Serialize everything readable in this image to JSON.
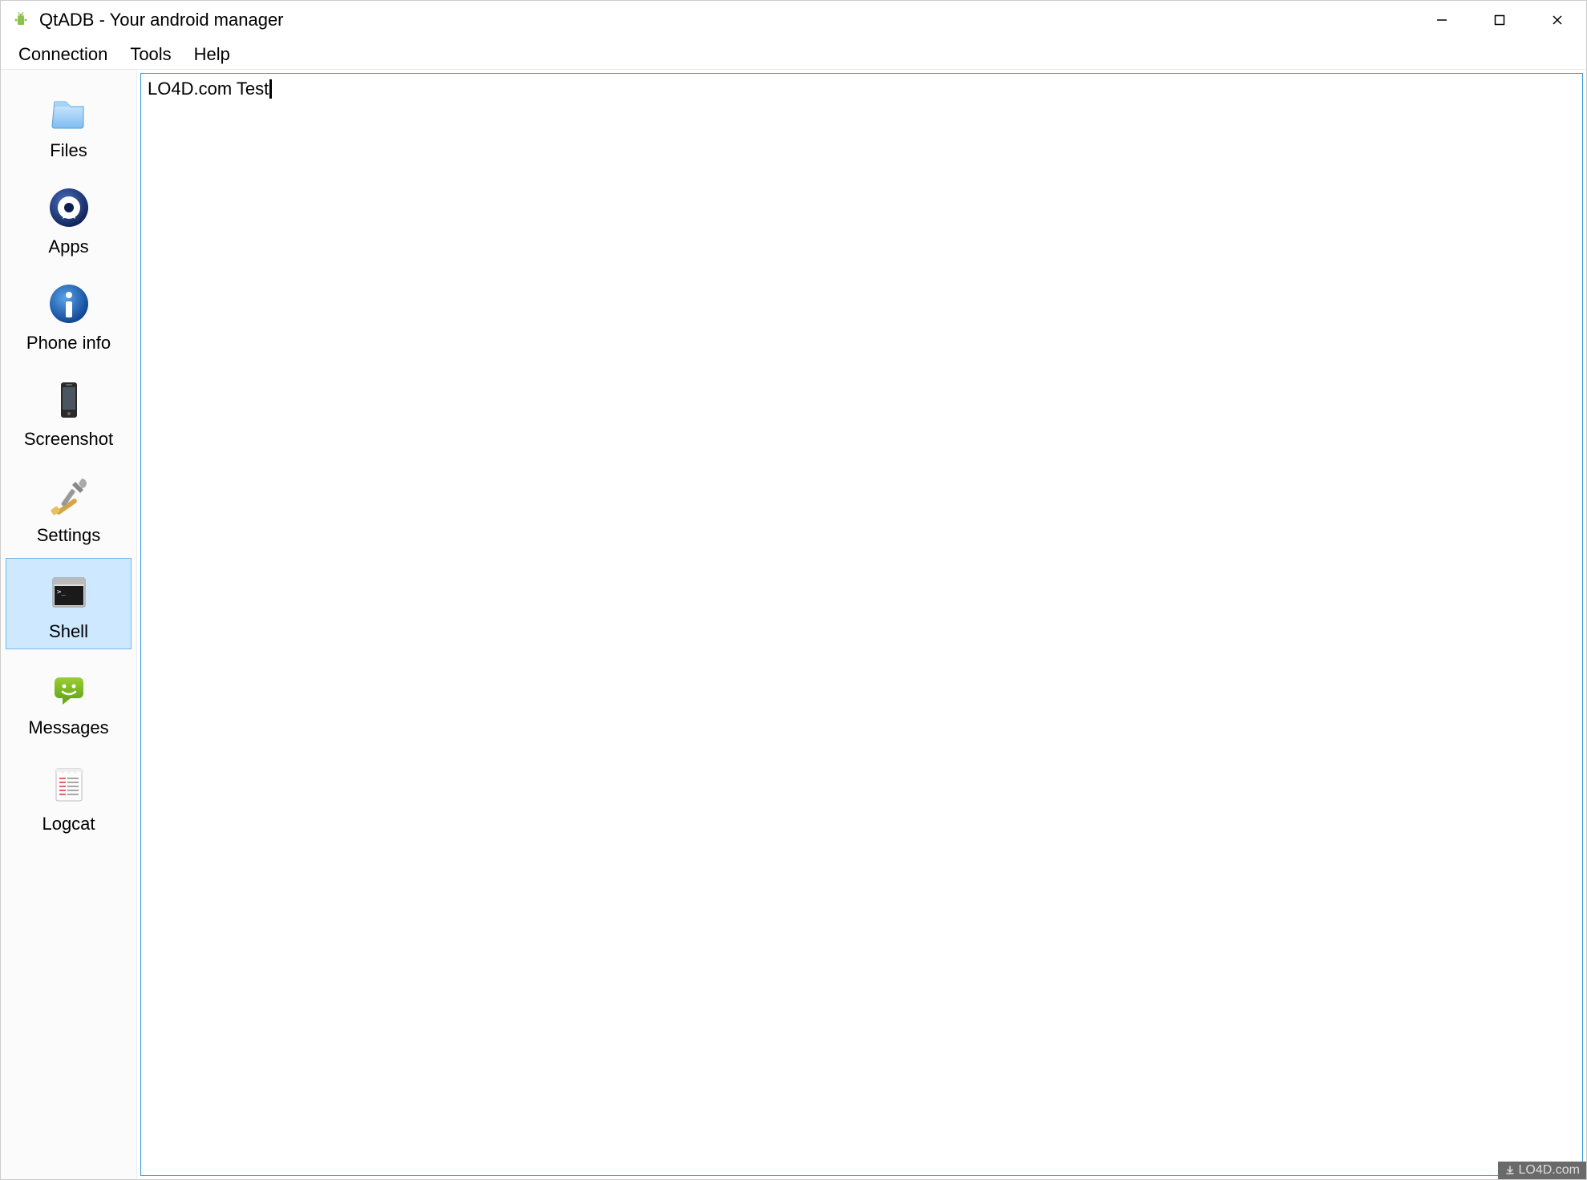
{
  "window": {
    "title": "QtADB - Your android manager"
  },
  "menubar": {
    "items": [
      "Connection",
      "Tools",
      "Help"
    ]
  },
  "sidebar": {
    "items": [
      {
        "id": "files",
        "label": "Files",
        "icon": "files-icon",
        "selected": false
      },
      {
        "id": "apps",
        "label": "Apps",
        "icon": "apps-icon",
        "selected": false
      },
      {
        "id": "phoneinfo",
        "label": "Phone info",
        "icon": "info-icon",
        "selected": false
      },
      {
        "id": "screenshot",
        "label": "Screenshot",
        "icon": "screenshot-icon",
        "selected": false
      },
      {
        "id": "settings",
        "label": "Settings",
        "icon": "settings-icon",
        "selected": false
      },
      {
        "id": "shell",
        "label": "Shell",
        "icon": "shell-icon",
        "selected": true
      },
      {
        "id": "messages",
        "label": "Messages",
        "icon": "messages-icon",
        "selected": false
      },
      {
        "id": "logcat",
        "label": "Logcat",
        "icon": "logcat-icon",
        "selected": false
      }
    ]
  },
  "shell": {
    "content": "LO4D.com Test"
  },
  "watermark": {
    "corner": "LO4D.com"
  }
}
